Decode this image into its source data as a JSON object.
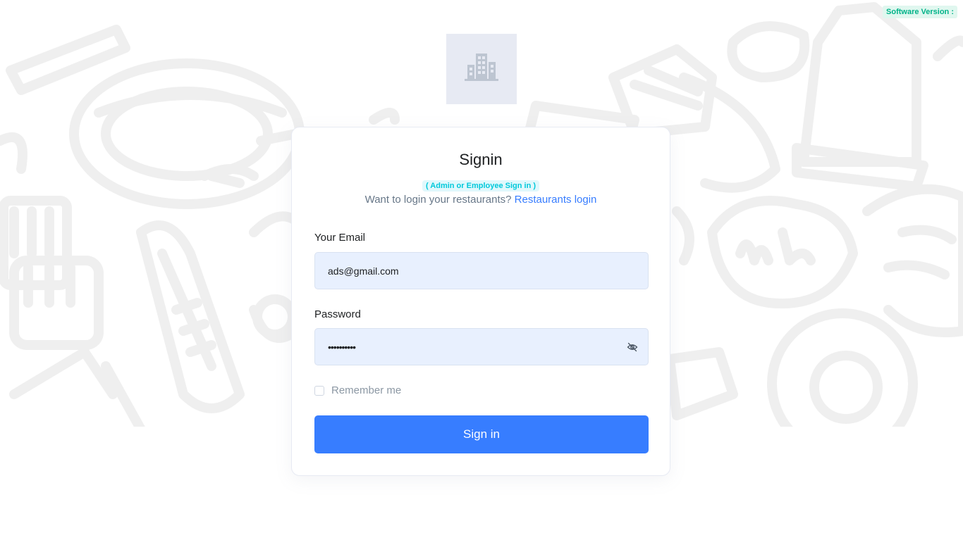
{
  "header": {
    "software_version_label": "Software Version :"
  },
  "logo": {
    "icon": "building-icon"
  },
  "card": {
    "title": "Signin",
    "subtitle_badge": "( Admin or Employee Sign in )",
    "restaurants_prompt": "Want to login your restaurants?",
    "restaurants_link": "Restaurants login"
  },
  "form": {
    "email_label": "Your Email",
    "email_value": "ads@gmail.com",
    "password_label": "Password",
    "password_value": "••••••••••",
    "password_toggle_icon": "eye-slash-icon",
    "remember_label": "Remember me",
    "remember_checked": false,
    "submit_label": "Sign in"
  },
  "colors": {
    "primary": "#377dff",
    "input_bg": "#e8f0fe",
    "badge_teal": "#00c9db",
    "version_green": "#00b389",
    "logo_bg": "#e7eaf3"
  }
}
